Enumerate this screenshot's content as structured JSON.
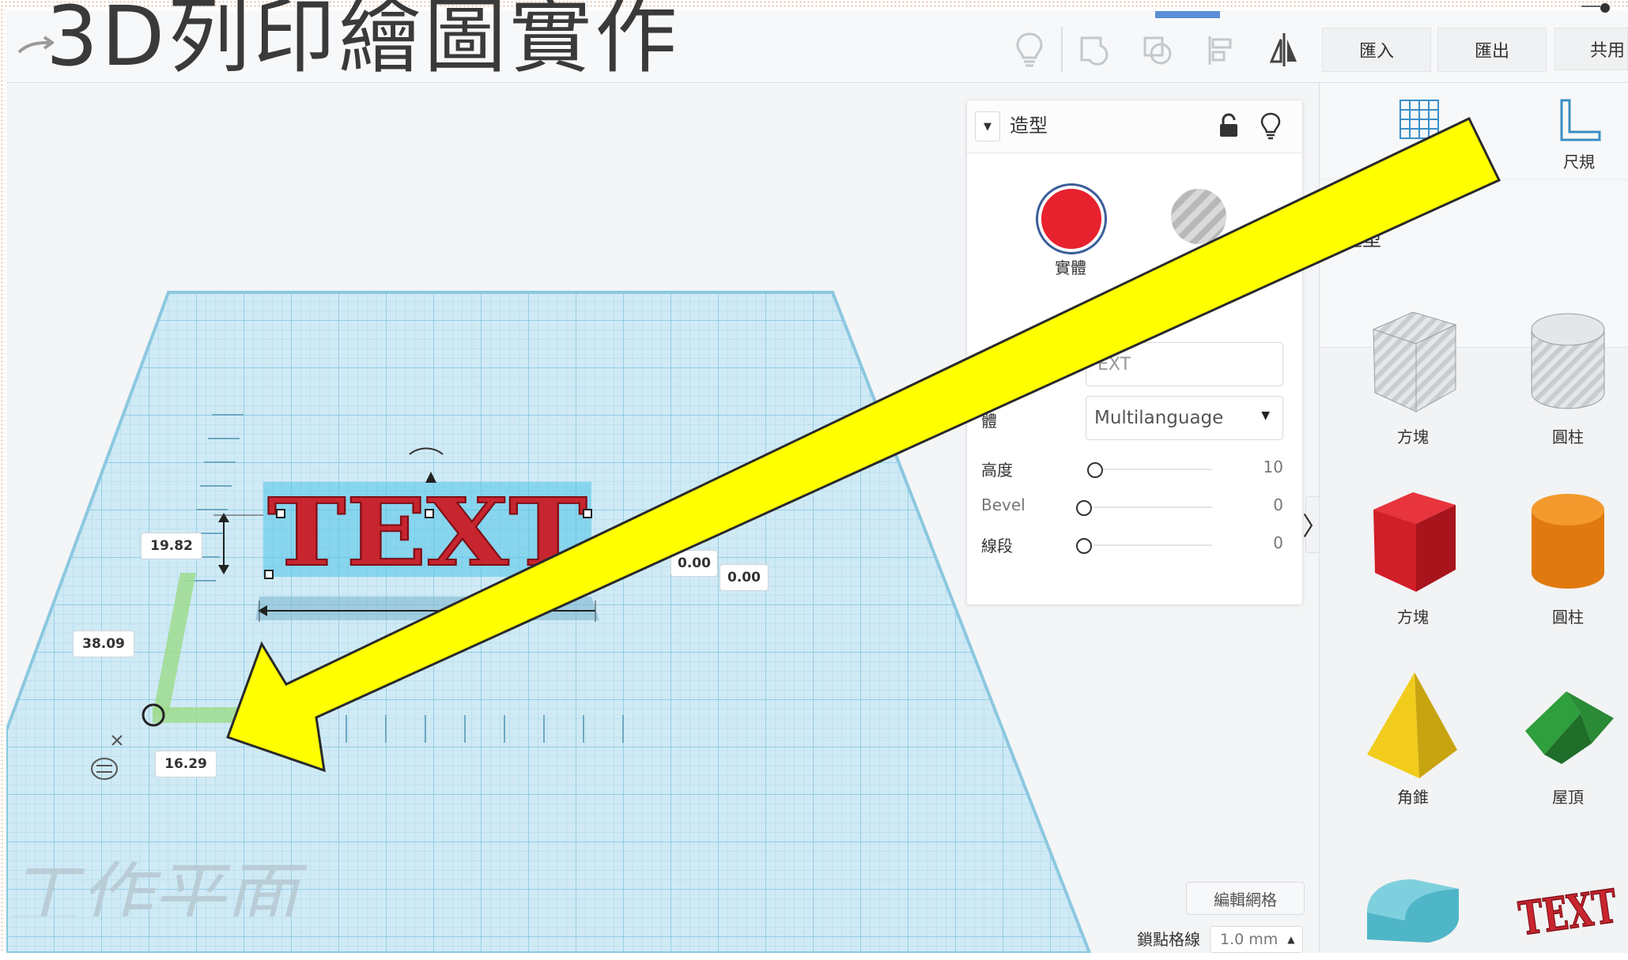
{
  "slide": {
    "title": "3D列印繪圖實作"
  },
  "toolbar": {
    "icons": [
      "lightbulb-icon",
      "group-icon",
      "ungroup-icon",
      "align-icon",
      "mirror-icon"
    ],
    "import_label": "匯入",
    "export_label": "匯出",
    "share_label": "共用"
  },
  "inspector": {
    "title": "造型",
    "solid_label": "實體",
    "text_value": "EXT",
    "font_label": "體",
    "font_value": "Multilanguage",
    "height_label": "高度",
    "height_value": "10",
    "bevel_label": "Bevel",
    "bevel_value": "0",
    "segments_label": "線段",
    "segments_value": "0"
  },
  "workplane": {
    "label": "工作平面",
    "dim_height": "19.82",
    "dim_length": "38.09",
    "dim_width": "16.29",
    "dim_offset_a": "0.00",
    "dim_offset_b": "0.00",
    "shape_text": "TEXT",
    "edit_grid_label": "編輯網格",
    "snap_label": "鎖點格線",
    "snap_value": "1.0 mm"
  },
  "shapes_panel": {
    "ruler_label": "尺規",
    "category_label": "造型",
    "items": [
      {
        "label": "方塊"
      },
      {
        "label": "圓柱"
      },
      {
        "label": "方塊"
      },
      {
        "label": "圓柱"
      },
      {
        "label": "角錐"
      },
      {
        "label": "屋頂"
      }
    ]
  },
  "colors": {
    "arrow_fill": "#ffff00",
    "solid_red": "#e8212e",
    "grid_blue": "#bfe4f2",
    "accent_blue": "#5b8fd6"
  }
}
